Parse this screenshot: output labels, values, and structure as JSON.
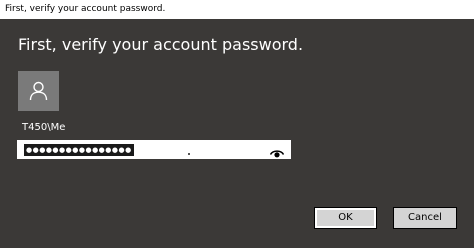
{
  "window": {
    "title": "First, verify your account password."
  },
  "dialog": {
    "heading": "First, verify your account password.",
    "avatar_icon": "user-icon",
    "account_name": "T450\\Me",
    "password": {
      "masked_value": "●●●●●●●●●●●●●●●●",
      "reveal_icon": "eye-icon"
    },
    "ok_label": "OK",
    "cancel_label": "Cancel"
  },
  "colors": {
    "background": "#3b3937",
    "avatar_bg": "#7a7a7a",
    "button_bg": "#d4d4d4",
    "text": "#ffffff"
  }
}
